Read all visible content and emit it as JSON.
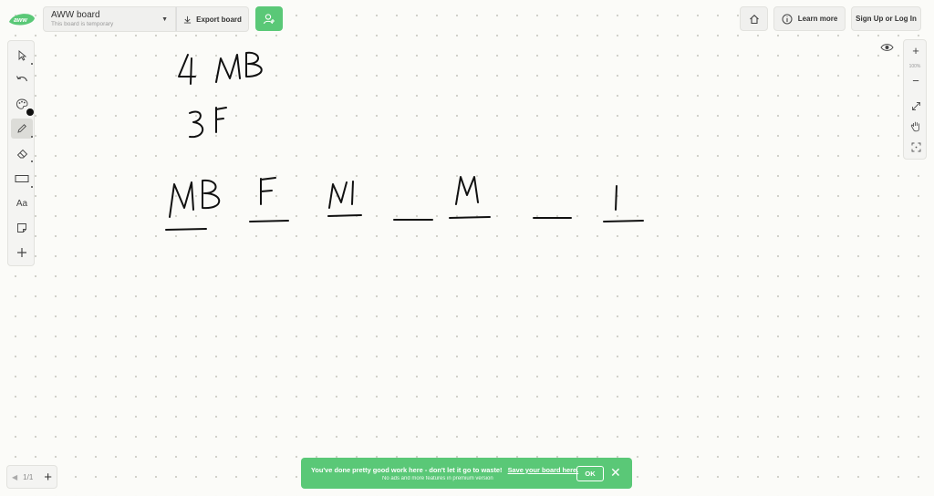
{
  "header": {
    "board_title": "AWW board",
    "board_subtitle": "This board is temporary",
    "export_label": "Export board",
    "learn_more_label": "Learn more",
    "signup_label": "Sign Up or Log In"
  },
  "toolbar": {
    "tools": [
      "select-tool",
      "undo-tool",
      "color-palette-tool",
      "pen-tool",
      "eraser-tool",
      "shape-tool",
      "text-tool",
      "sticky-note-tool",
      "add-tool"
    ],
    "text_tool_label": "Aa",
    "active_tool": "pen-tool",
    "selected_color": "#111111"
  },
  "zoom": {
    "zoom_in_label": "+",
    "level": "100%",
    "zoom_out_label": "−"
  },
  "pager": {
    "page_indicator": "1/1",
    "add_label": "+"
  },
  "banner": {
    "message": "You've done pretty good work here - don't let it go to waste!",
    "link_text": "Save your board here.",
    "subtext": "No ads and more features in premium version",
    "ok_label": "OK"
  },
  "colors": {
    "accent": "#5ac877",
    "ink": "#111111",
    "panel": "#f4f4f2"
  },
  "canvas_handwriting": [
    "4 MB",
    "3 F",
    "MB",
    "F",
    "M",
    "M",
    "I"
  ]
}
